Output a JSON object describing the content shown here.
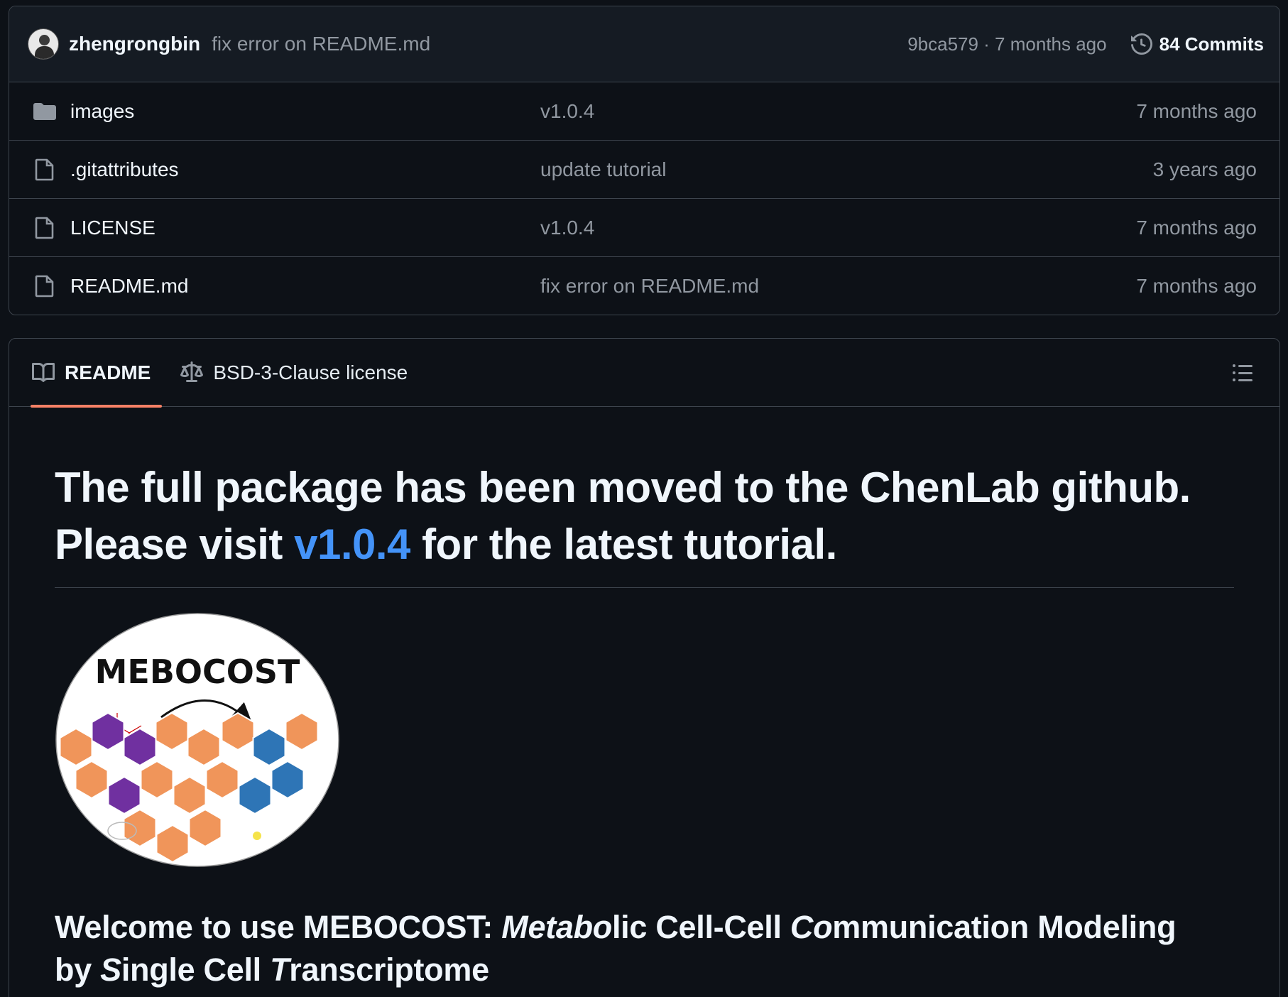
{
  "latest_commit": {
    "author": "zhengrongbin",
    "message": "fix error on README.md",
    "hash_time": "9bca579 · 7 months ago",
    "commits_label": "84 Commits"
  },
  "files": [
    {
      "name": "images",
      "type": "folder",
      "commit": "v1.0.4",
      "date": "7 months ago"
    },
    {
      "name": ".gitattributes",
      "type": "file",
      "commit": "update tutorial",
      "date": "3 years ago"
    },
    {
      "name": "LICENSE",
      "type": "file",
      "commit": "v1.0.4",
      "date": "7 months ago"
    },
    {
      "name": "README.md",
      "type": "file",
      "commit": "fix error on README.md",
      "date": "7 months ago"
    }
  ],
  "tabs": {
    "readme": "README",
    "license": "BSD-3-Clause license"
  },
  "readme": {
    "headline_line1": "The full package has been moved to the ChenLab github.",
    "headline_line2_pre": "Please visit ",
    "headline_link": "v1.0.4",
    "headline_line2_post": " for the latest tutorial.",
    "logo_text": "MEBOCOST",
    "welcome_pre": "Welcome to use MEBOCOST: ",
    "welcome_meta": "Metabo",
    "welcome_lic": "lic Cell-Cell ",
    "welcome_co": "Co",
    "welcome_mm": "mmunication Modeling",
    "welcome_by": "by ",
    "welcome_s": "S",
    "welcome_ingle": "ingle Cell ",
    "welcome_t": "T",
    "welcome_rans": "ranscriptome"
  },
  "colors": {
    "background": "#0d1117",
    "link": "#4493f8",
    "tab_underline": "#f78166",
    "hex_orange": "#f0955a",
    "hex_purple": "#7030a0",
    "hex_blue": "#2e75b6"
  }
}
